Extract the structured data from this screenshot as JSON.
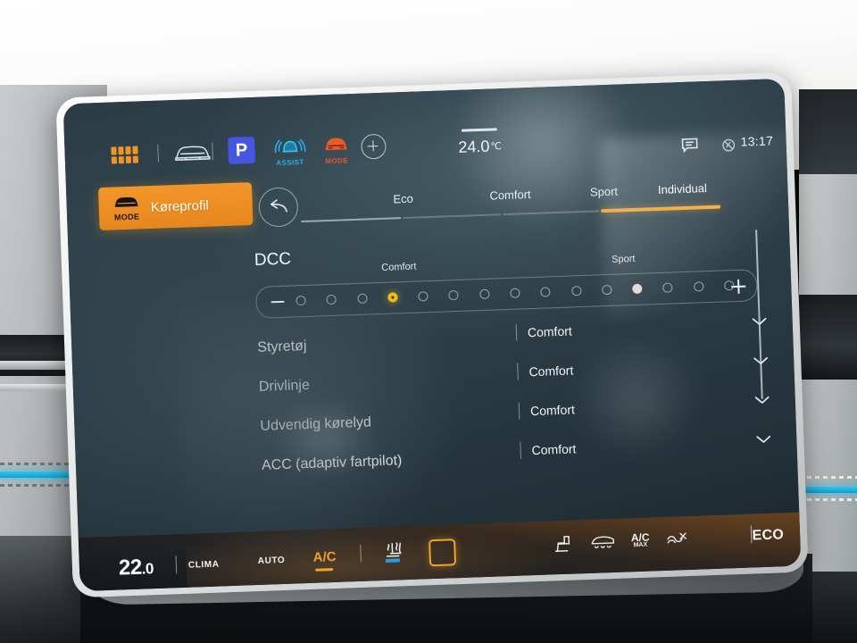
{
  "statusbar": {
    "apps_icon": "apps-grid-icon",
    "car_icon": "car-front-icon",
    "park_label": "P",
    "assist_label": "ASSIST",
    "assist_icon": "assist-car-icon",
    "mode_label": "MODE",
    "mode_icon": "drive-mode-car-icon",
    "add_icon": "plus-circle-icon",
    "temperature": "24.0",
    "temperature_unit": "℃",
    "message_icon": "message-bubble-icon",
    "mute_icon": "mute-notification-icon",
    "clock": "13:17"
  },
  "header": {
    "profile_label": "Køreprofil",
    "profile_icon": "drive-mode-car-icon",
    "profile_icon_label": "MODE",
    "back_icon": "back-arrow-icon",
    "accent_color": "#f0a12b"
  },
  "tabs": [
    {
      "label": "Eco",
      "active": false
    },
    {
      "label": "Comfort",
      "active": false
    },
    {
      "label": "Sport",
      "active": false
    },
    {
      "label": "Individual",
      "active": true
    }
  ],
  "dcc": {
    "title": "DCC",
    "left_label": "Comfort",
    "right_label": "Sport",
    "minus_icon": "minus-icon",
    "plus_icon": "plus-icon",
    "steps": 15,
    "selected_index": 3,
    "marked_index": 11
  },
  "settings_rows": [
    {
      "name": "Styretøj",
      "value": "Comfort",
      "chevron": "chevron-down-icon"
    },
    {
      "name": "Drivlinje",
      "value": "Comfort",
      "chevron": "chevron-down-icon"
    },
    {
      "name": "Udvendig kørelyd",
      "value": "Comfort",
      "chevron": "chevron-down-icon"
    },
    {
      "name": "ACC (adaptiv fartpilot)",
      "value": "Comfort",
      "chevron": "chevron-down-icon"
    }
  ],
  "climate": {
    "temp_int": "22",
    "temp_dec": ".0",
    "clima_label": "CLIMA",
    "auto_label": "AUTO",
    "ac_label": "A/C",
    "ac_active": true,
    "seat_icon": "seat-climate-icon",
    "home_icon": "home-square-icon",
    "seat_heat_icon": "seat-heating-icon",
    "defrost_icon": "windshield-defrost-icon",
    "acmax_top": "A/C",
    "acmax_bottom": "MAX",
    "fan_icon": "fan-off-icon",
    "eco_label": "ECO",
    "accent_color": "#f0a52a"
  }
}
